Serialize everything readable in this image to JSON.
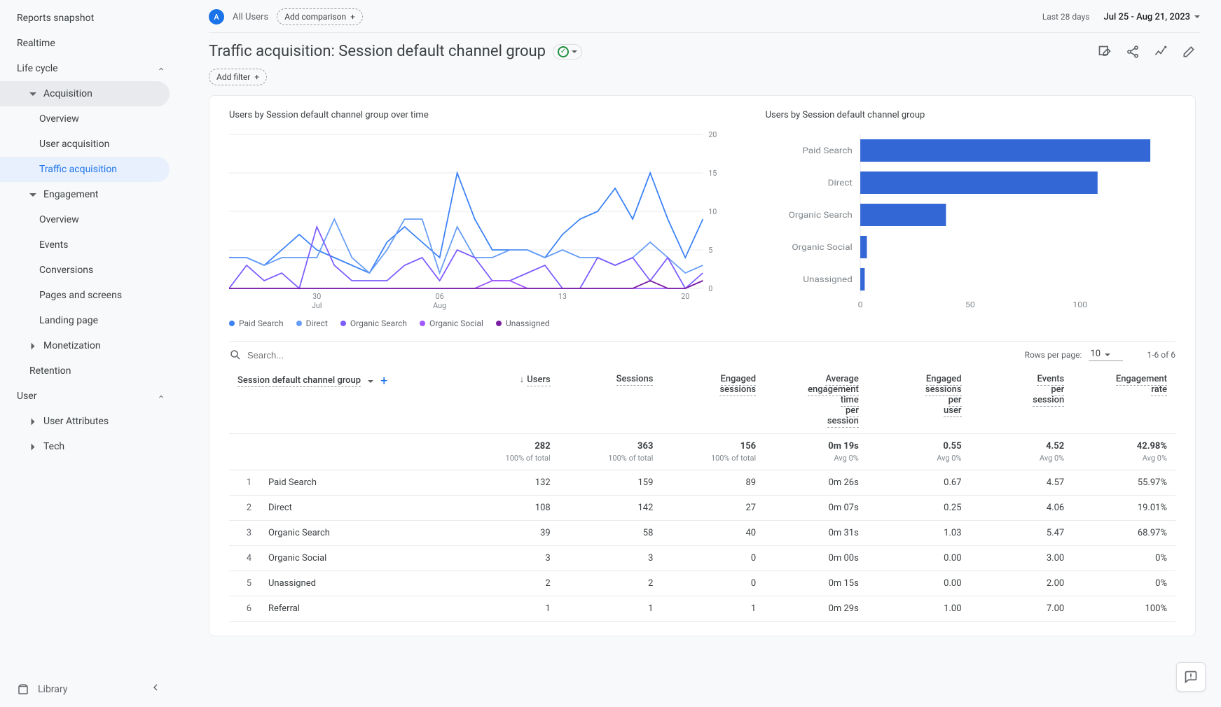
{
  "sidebar": {
    "reports_snapshot": "Reports snapshot",
    "realtime": "Realtime",
    "sections": {
      "lifecycle": {
        "label": "Life cycle",
        "acquisition": {
          "label": "Acquisition",
          "overview": "Overview",
          "user_acquisition": "User acquisition",
          "traffic_acquisition": "Traffic acquisition"
        },
        "engagement": {
          "label": "Engagement",
          "overview": "Overview",
          "events": "Events",
          "conversions": "Conversions",
          "pages": "Pages and screens",
          "landing": "Landing page"
        },
        "monetization": "Monetization",
        "retention": "Retention"
      },
      "user": {
        "label": "User",
        "user_attributes": "User Attributes",
        "tech": "Tech"
      }
    },
    "library": "Library"
  },
  "header": {
    "all_users": "All Users",
    "add_comparison": "Add comparison",
    "date_label": "Last 28 days",
    "date_range": "Jul 25 - Aug 21, 2023",
    "title": "Traffic acquisition: Session default channel group",
    "add_filter": "Add filter"
  },
  "charts": {
    "line_title": "Users by Session default channel group over time",
    "bar_title": "Users by Session default channel group",
    "legend": [
      "Paid Search",
      "Direct",
      "Organic Search",
      "Organic Social",
      "Unassigned"
    ]
  },
  "chart_data": [
    {
      "type": "line",
      "title": "Users by Session default channel group over time",
      "xlabel": "",
      "ylabel": "",
      "ylim": [
        0,
        20
      ],
      "x_ticks": [
        {
          "label": "30",
          "sub": "Jul",
          "idx": 5
        },
        {
          "label": "06",
          "sub": "Aug",
          "idx": 12
        },
        {
          "label": "13",
          "sub": "",
          "idx": 19
        },
        {
          "label": "20",
          "sub": "",
          "idx": 26
        }
      ],
      "x": [
        "Jul 25",
        "Jul 26",
        "Jul 27",
        "Jul 28",
        "Jul 29",
        "Jul 30",
        "Jul 31",
        "Aug 01",
        "Aug 02",
        "Aug 03",
        "Aug 04",
        "Aug 05",
        "Aug 06",
        "Aug 07",
        "Aug 08",
        "Aug 09",
        "Aug 10",
        "Aug 11",
        "Aug 12",
        "Aug 13",
        "Aug 14",
        "Aug 15",
        "Aug 16",
        "Aug 17",
        "Aug 18",
        "Aug 19",
        "Aug 20",
        "Aug 21"
      ],
      "series": [
        {
          "name": "Paid Search",
          "color": "#3b82f6",
          "values": [
            4,
            4,
            3,
            5,
            7,
            5,
            4,
            3,
            2,
            6,
            8,
            6,
            4,
            15,
            9,
            5,
            5,
            5,
            4,
            7,
            9,
            10,
            13,
            9,
            15,
            9,
            4,
            9
          ]
        },
        {
          "name": "Direct",
          "color": "#669df6",
          "values": [
            4,
            4,
            3,
            4,
            4,
            4,
            9,
            4,
            2,
            5,
            9,
            9,
            2,
            8,
            4,
            4,
            5,
            5,
            4,
            5,
            4,
            4,
            3,
            4,
            6,
            4,
            2,
            3
          ]
        },
        {
          "name": "Organic Search",
          "color": "#7c5cff",
          "values": [
            0,
            3,
            1,
            2,
            0,
            8,
            3,
            1,
            1,
            1,
            3,
            4,
            1,
            5,
            4,
            1,
            1,
            2,
            3,
            0,
            0,
            4,
            3,
            4,
            1,
            4,
            0,
            2
          ]
        },
        {
          "name": "Organic Social",
          "color": "#a259ff",
          "values": [
            0,
            0,
            0,
            0,
            0,
            0,
            0,
            0,
            0,
            0,
            0,
            0,
            0,
            0,
            0,
            1,
            1,
            0,
            0,
            0,
            0,
            0,
            0,
            0,
            0,
            0,
            0,
            1
          ]
        },
        {
          "name": "Unassigned",
          "color": "#7b1fa2",
          "values": [
            0,
            0,
            0,
            0,
            0,
            0,
            0,
            0,
            0,
            0,
            0,
            0,
            0,
            0,
            0,
            0,
            0,
            0,
            0,
            0,
            0,
            0,
            0,
            0,
            1,
            0,
            0,
            1
          ]
        }
      ]
    },
    {
      "type": "bar",
      "title": "Users by Session default channel group",
      "orientation": "horizontal",
      "xlim": [
        0,
        140
      ],
      "x_ticks": [
        0,
        50,
        100
      ],
      "color": "#3367d6",
      "categories": [
        "Paid Search",
        "Direct",
        "Organic Search",
        "Organic Social",
        "Unassigned"
      ],
      "values": [
        132,
        108,
        39,
        3,
        2
      ]
    }
  ],
  "table": {
    "search_placeholder": "Search...",
    "rows_per_page_label": "Rows per page:",
    "rows_per_page_value": "10",
    "page_info": "1-6 of 6",
    "dimension_label": "Session default channel group",
    "columns": [
      "Users",
      "Sessions",
      "Engaged sessions",
      "Average engagement time per session",
      "Engaged sessions per user",
      "Events per session",
      "Engagement rate"
    ],
    "totals": {
      "values": [
        "282",
        "363",
        "156",
        "0m 19s",
        "0.55",
        "4.52",
        "42.98%"
      ],
      "subs": [
        "100% of total",
        "100% of total",
        "100% of total",
        "Avg 0%",
        "Avg 0%",
        "Avg 0%",
        "Avg 0%"
      ]
    },
    "rows": [
      {
        "idx": "1",
        "dim": "Paid Search",
        "cells": [
          "132",
          "159",
          "89",
          "0m 26s",
          "0.67",
          "4.57",
          "55.97%"
        ]
      },
      {
        "idx": "2",
        "dim": "Direct",
        "cells": [
          "108",
          "142",
          "27",
          "0m 07s",
          "0.25",
          "4.06",
          "19.01%"
        ]
      },
      {
        "idx": "3",
        "dim": "Organic Search",
        "cells": [
          "39",
          "58",
          "40",
          "0m 31s",
          "1.03",
          "5.47",
          "68.97%"
        ]
      },
      {
        "idx": "4",
        "dim": "Organic Social",
        "cells": [
          "3",
          "3",
          "0",
          "0m 00s",
          "0.00",
          "3.00",
          "0%"
        ]
      },
      {
        "idx": "5",
        "dim": "Unassigned",
        "cells": [
          "2",
          "2",
          "0",
          "0m 15s",
          "0.00",
          "2.00",
          "0%"
        ]
      },
      {
        "idx": "6",
        "dim": "Referral",
        "cells": [
          "1",
          "1",
          "1",
          "0m 29s",
          "1.00",
          "7.00",
          "100%"
        ]
      }
    ]
  }
}
